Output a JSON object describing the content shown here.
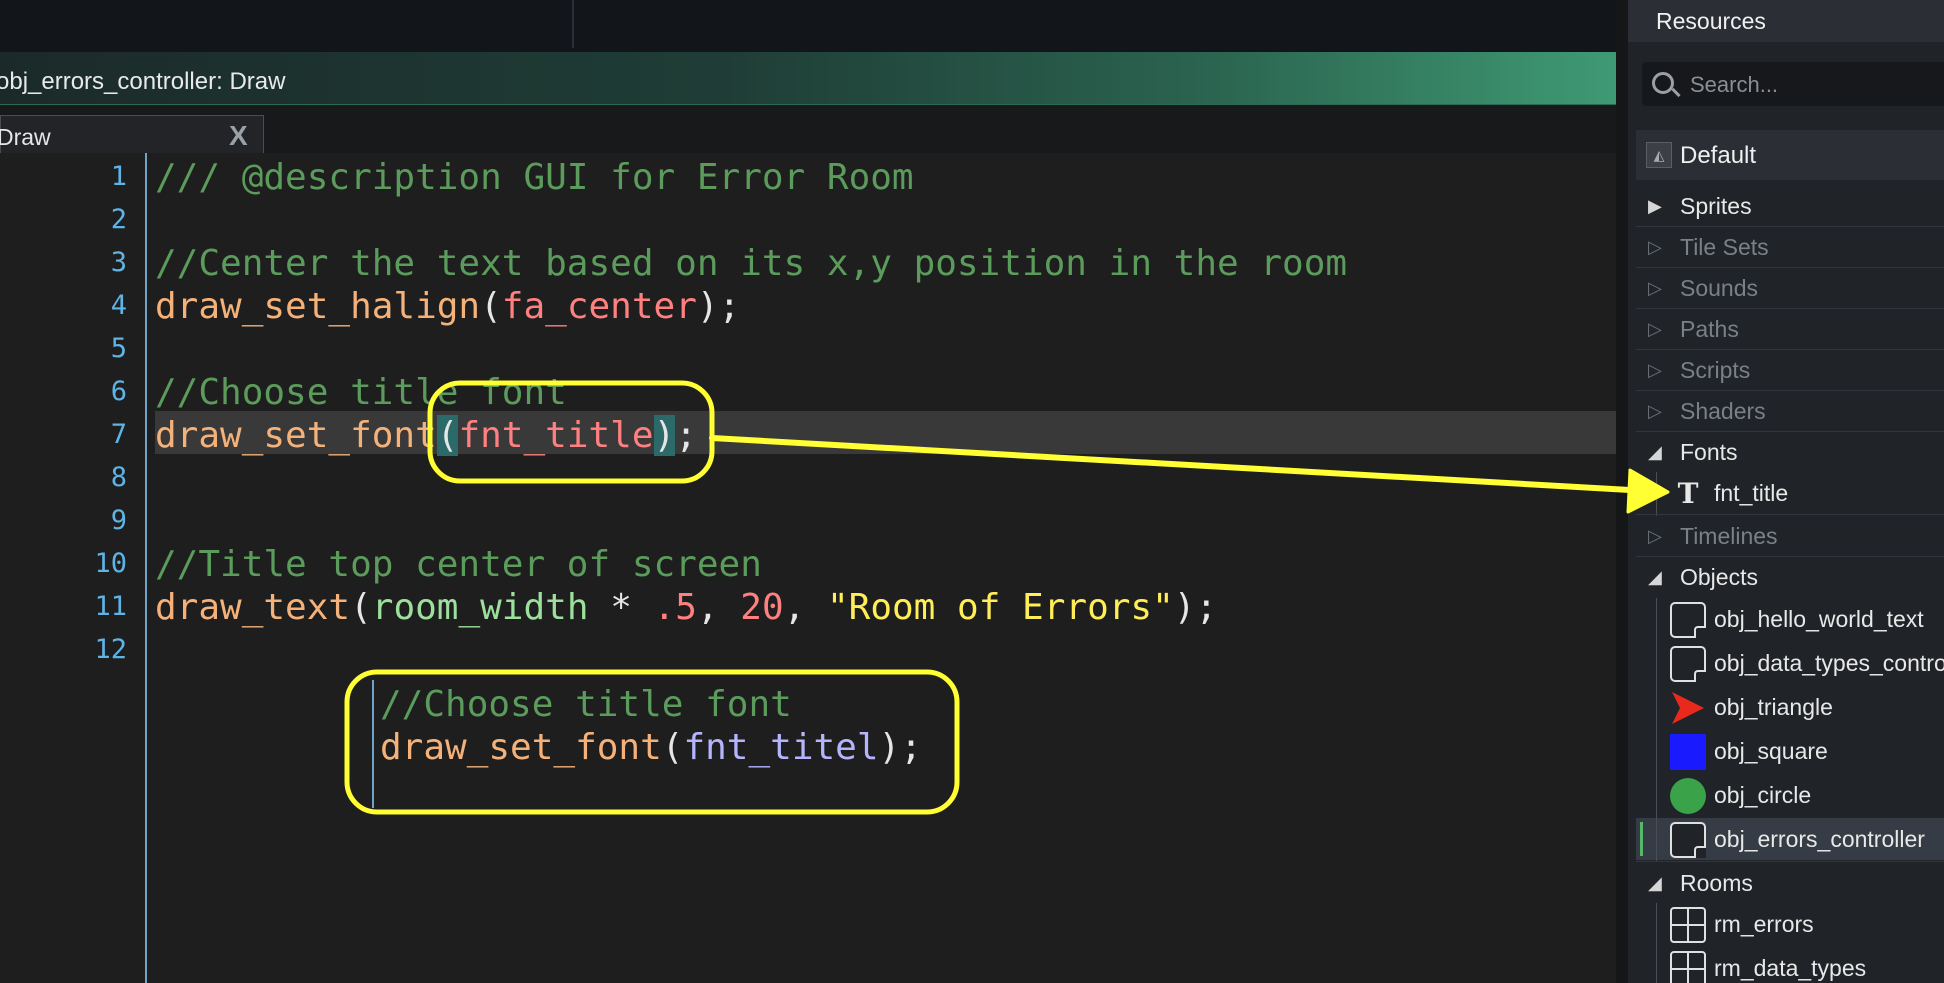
{
  "window": {
    "title": "obj_errors_controller: Draw",
    "tab_label": "Draw",
    "tab_close": "X"
  },
  "editor": {
    "line_numbers": [
      "1",
      "2",
      "3",
      "4",
      "5",
      "6",
      "7",
      "8",
      "9",
      "10",
      "11",
      "12"
    ],
    "lines": {
      "l1": "/// @description GUI for Error Room",
      "l3": "//Center the text based on its x,y position in the room",
      "l4_fn": "draw_set_halign",
      "l4_arg": "fa_center",
      "l6": "//Choose title font",
      "l7_fn": "draw_set_font",
      "l7_arg": "fnt_title",
      "l10": "//Title top center of screen",
      "l11_fn": "draw_text",
      "l11_a": "room_width",
      "l11_op": " * ",
      "l11_b": ".5",
      "l11_c": "20",
      "l11_s": "\"Room of Errors\""
    },
    "popup": {
      "comment": "//Choose title font",
      "fn": "draw_set_font",
      "arg": "fnt_titel"
    }
  },
  "resources": {
    "title": "Resources",
    "search_placeholder": "Search...",
    "preset": "Default",
    "groups": {
      "sprites": "Sprites",
      "tile_sets": "Tile Sets",
      "sounds": "Sounds",
      "paths": "Paths",
      "scripts": "Scripts",
      "shaders": "Shaders",
      "fonts": "Fonts",
      "timelines": "Timelines",
      "objects": "Objects",
      "rooms": "Rooms"
    },
    "fonts": [
      "fnt_title"
    ],
    "objects": [
      "obj_hello_world_text",
      "obj_data_types_controller",
      "obj_triangle",
      "obj_square",
      "obj_circle",
      "obj_errors_controller"
    ],
    "rooms": [
      "rm_errors",
      "rm_data_types"
    ]
  },
  "colors": {
    "comment": "#5b9b5b",
    "function": "#f4b27a",
    "constant": "#ff8080",
    "string": "#ffee55",
    "annotation": "#ffff33",
    "square": "#1a1aff",
    "triangle": "#e8291c",
    "circle": "#3aa34a"
  }
}
